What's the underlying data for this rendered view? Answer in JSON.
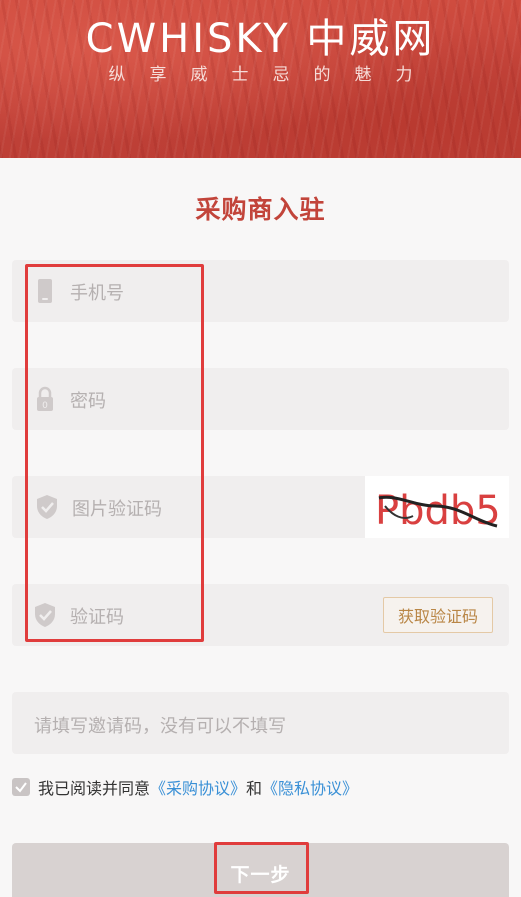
{
  "header": {
    "logo_text": "CWHISKY 中威网",
    "slogan": "纵享威士忌的魅力"
  },
  "page_title": "采购商入驻",
  "form": {
    "phone_placeholder": "手机号",
    "password_placeholder": "密码",
    "image_code_placeholder": "图片验证码",
    "captcha_text": "Pbdb5",
    "sms_code_placeholder": "验证码",
    "sms_button_label": "获取验证码",
    "invite_placeholder": "请填写邀请码，没有可以不填写"
  },
  "agreement": {
    "prefix": "我已阅读并同意",
    "purchase_link": "《采购协议》",
    "and": "和",
    "privacy_link": "《隐私协议》"
  },
  "next_button_label": "下一步",
  "colors": {
    "brand_red": "#c2443a",
    "link_blue": "#3a90d6",
    "annotation_red": "#e03c3c"
  }
}
